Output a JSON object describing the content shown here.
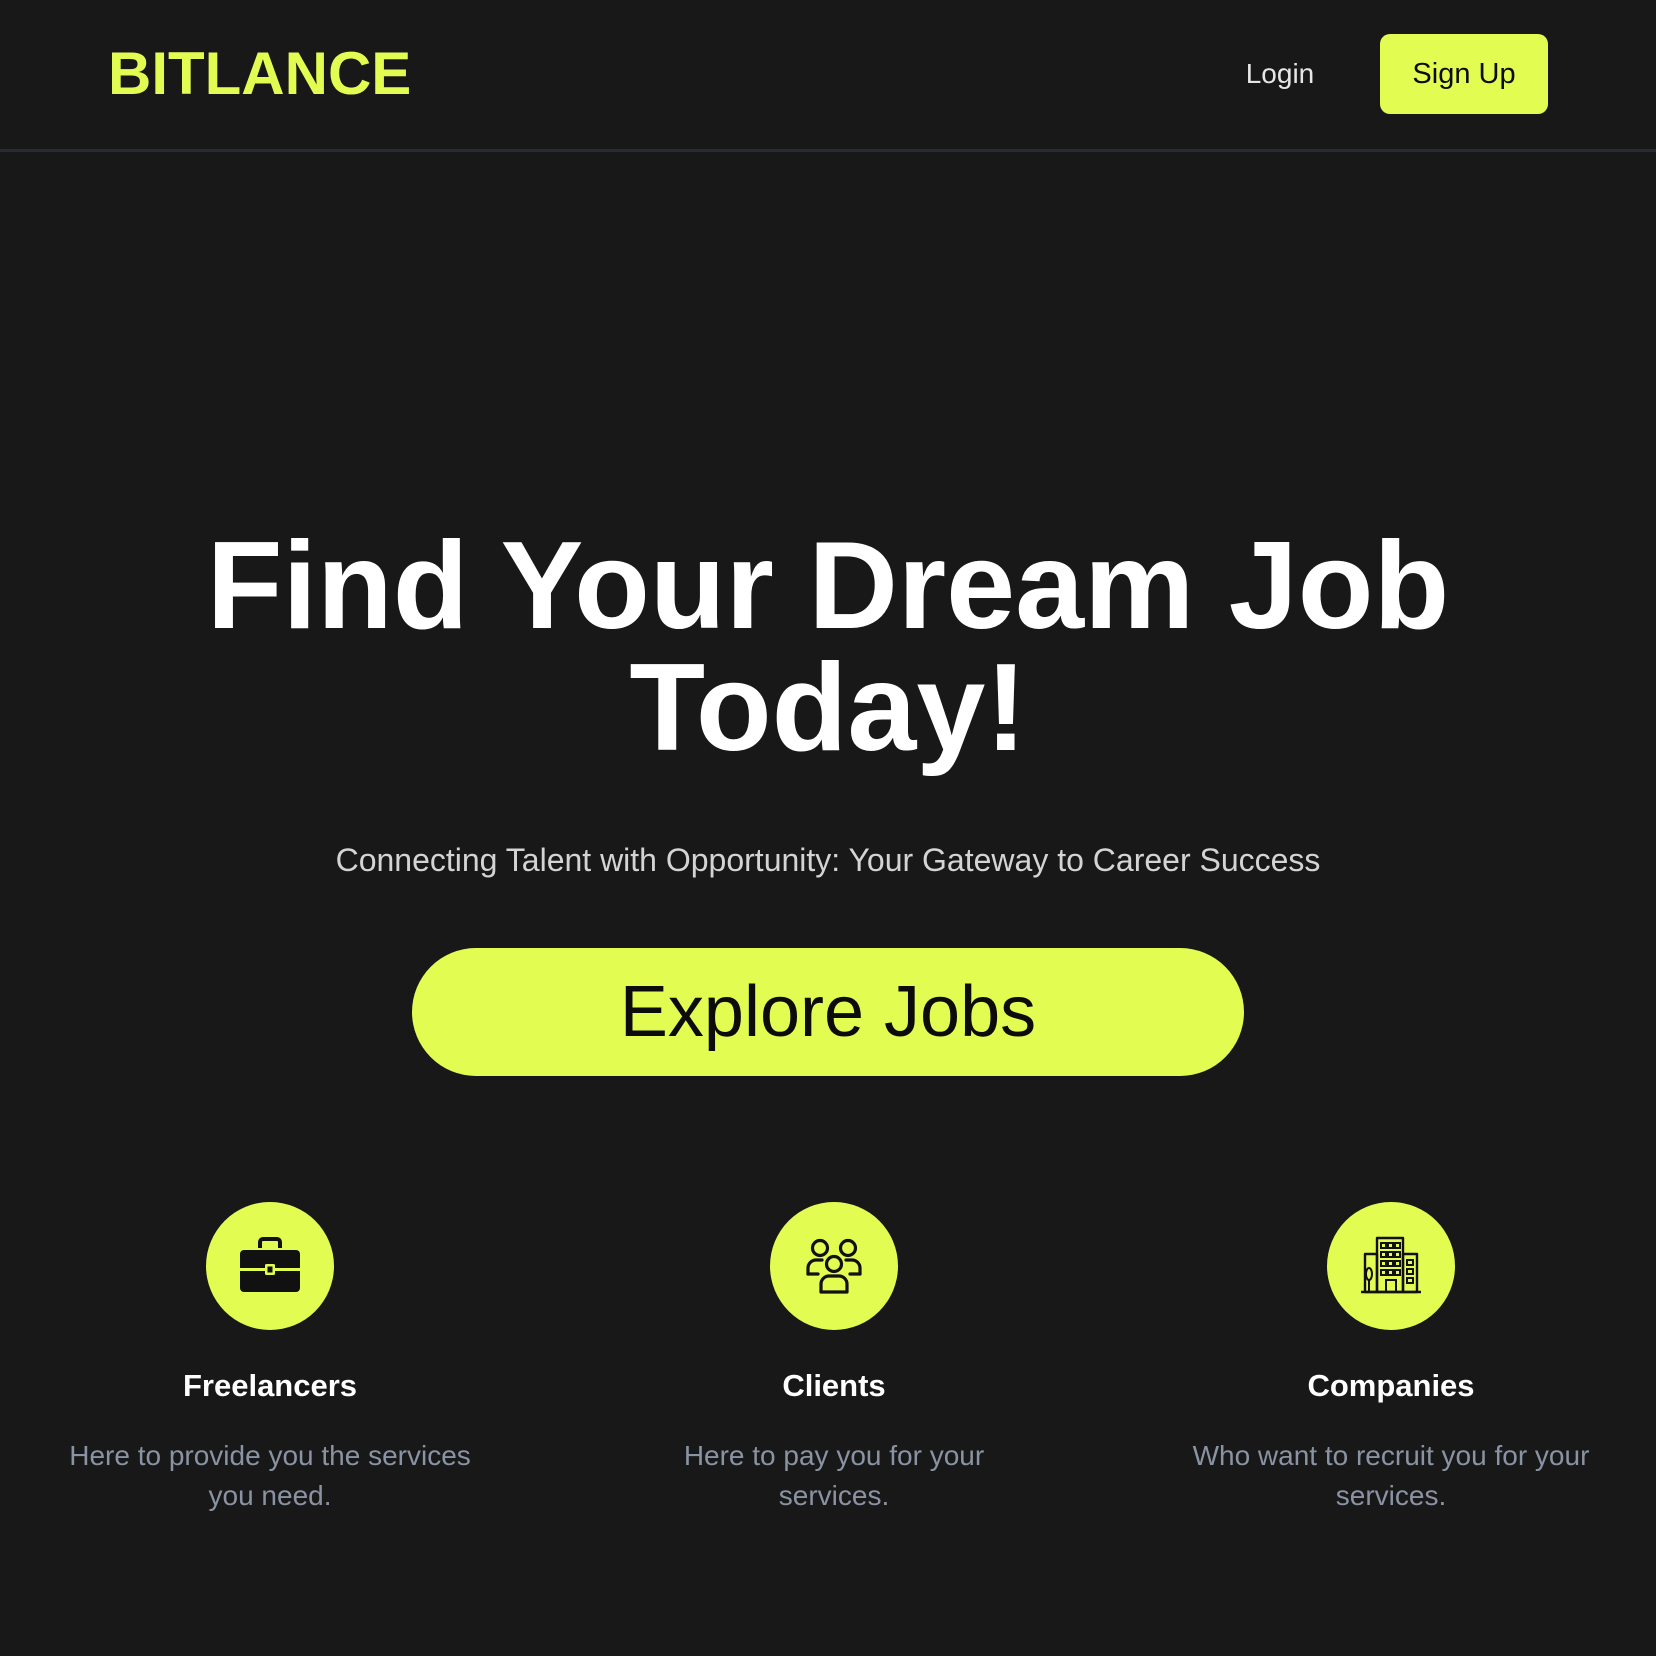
{
  "brand": {
    "logo": "BITLANCE",
    "accent_color": "#e3fc52",
    "background_color": "#181818"
  },
  "nav": {
    "login_label": "Login",
    "signup_label": "Sign Up"
  },
  "hero": {
    "title_line1": "Find Your Dream Job",
    "title_line2": "Today!",
    "subtitle": "Connecting Talent with Opportunity: Your Gateway to Career Success",
    "cta_label": "Explore Jobs"
  },
  "features": [
    {
      "icon": "briefcase-icon",
      "title": "Freelancers",
      "desc_line1": "Here to provide you the services",
      "desc_line2": "you need."
    },
    {
      "icon": "users-group-icon",
      "title": "Clients",
      "desc_line1": "Here to pay you for your",
      "desc_line2": "services."
    },
    {
      "icon": "building-icon",
      "title": "Companies",
      "desc_line1": "Who want to recruit you for your",
      "desc_line2": "services."
    }
  ]
}
